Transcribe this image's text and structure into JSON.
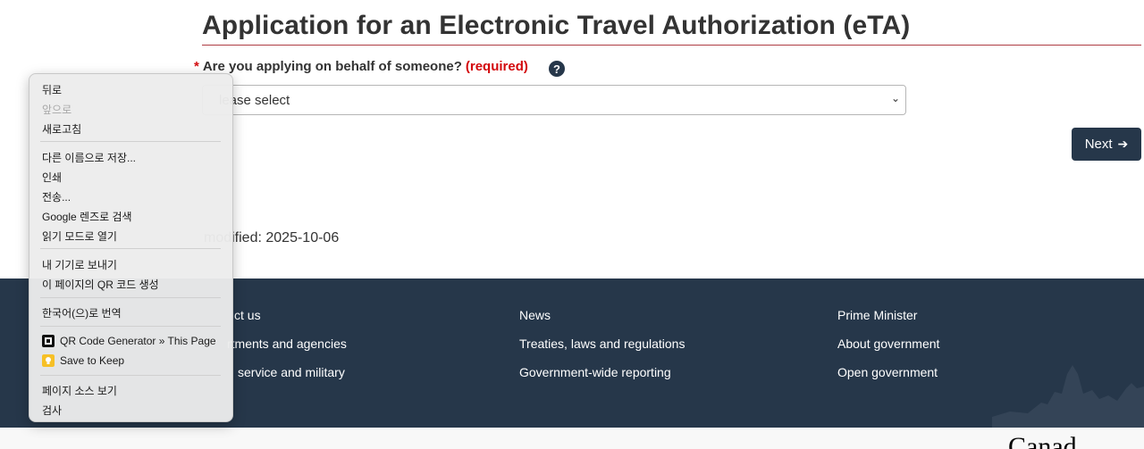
{
  "page": {
    "title": "Application for an Electronic Travel Authorization (eTA)",
    "question_star": "*",
    "question": "Are you applying on behalf of someone?",
    "required": "(required)",
    "help_icon": "?",
    "select_placeholder": "lease select",
    "next_button": "Next",
    "date_modified": "modified: 2025-10-06"
  },
  "footer": {
    "col1": [
      "ct us",
      "rtments and agencies",
      "service and military"
    ],
    "col2": [
      "News",
      "Treaties, laws and regulations",
      "Government-wide reporting"
    ],
    "col3": [
      "Prime Minister",
      "About government",
      "Open government"
    ]
  },
  "wordmark": "Canad",
  "context_menu": {
    "back": "뒤로",
    "forward": "앞으로",
    "reload": "새로고침",
    "save_as": "다른 이름으로 저장...",
    "print": "인쇄",
    "cast": "전송...",
    "google_lens": "Google 렌즈로 검색",
    "reading_mode": "읽기 모드로 열기",
    "send_to_devices": "내 기기로 보내기",
    "qr_code": "이 페이지의 QR 코드 생성",
    "translate": "한국어(으)로 번역",
    "qr_generator_ext": "QR Code Generator » This Page",
    "save_to_keep": "Save to Keep",
    "view_source": "페이지 소스 보기",
    "inspect": "검사"
  },
  "colors": {
    "footer_bg": "#26374a",
    "title_rule": "#af3c43",
    "required": "#d3080c",
    "keep_yellow": "#f6c026"
  }
}
